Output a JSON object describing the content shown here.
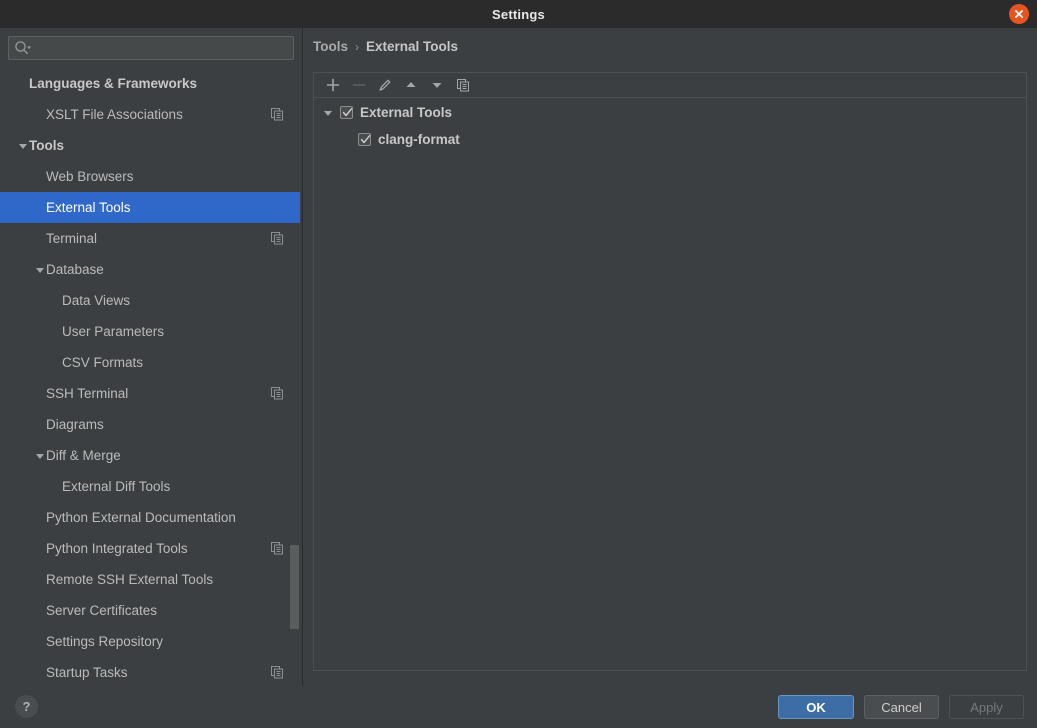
{
  "window": {
    "title": "Settings",
    "close_icon": "close-icon"
  },
  "sidebar": {
    "search": {
      "value": "",
      "placeholder": "",
      "icon": "search-icon"
    },
    "items": [
      {
        "label": "Languages & Frameworks",
        "level": 0,
        "bold": true,
        "arrow": "none",
        "selected": false,
        "badge": ""
      },
      {
        "label": "XSLT File Associations",
        "level": 1,
        "bold": false,
        "arrow": "none",
        "selected": false,
        "badge": "copy-icon"
      },
      {
        "label": "Tools",
        "level": 0,
        "bold": true,
        "arrow": "expanded",
        "selected": false,
        "badge": ""
      },
      {
        "label": "Web Browsers",
        "level": 1,
        "bold": false,
        "arrow": "none",
        "selected": false,
        "badge": ""
      },
      {
        "label": "External Tools",
        "level": 1,
        "bold": false,
        "arrow": "none",
        "selected": true,
        "badge": ""
      },
      {
        "label": "Terminal",
        "level": 1,
        "bold": false,
        "arrow": "none",
        "selected": false,
        "badge": "copy-icon"
      },
      {
        "label": "Database",
        "level": 1,
        "bold": false,
        "arrow": "expanded",
        "selected": false,
        "badge": ""
      },
      {
        "label": "Data Views",
        "level": 2,
        "bold": false,
        "arrow": "none",
        "selected": false,
        "badge": ""
      },
      {
        "label": "User Parameters",
        "level": 2,
        "bold": false,
        "arrow": "none",
        "selected": false,
        "badge": ""
      },
      {
        "label": "CSV Formats",
        "level": 2,
        "bold": false,
        "arrow": "none",
        "selected": false,
        "badge": ""
      },
      {
        "label": "SSH Terminal",
        "level": 1,
        "bold": false,
        "arrow": "none",
        "selected": false,
        "badge": "copy-icon"
      },
      {
        "label": "Diagrams",
        "level": 1,
        "bold": false,
        "arrow": "none",
        "selected": false,
        "badge": ""
      },
      {
        "label": "Diff & Merge",
        "level": 1,
        "bold": false,
        "arrow": "expanded",
        "selected": false,
        "badge": ""
      },
      {
        "label": "External Diff Tools",
        "level": 2,
        "bold": false,
        "arrow": "none",
        "selected": false,
        "badge": ""
      },
      {
        "label": "Python External Documentation",
        "level": 1,
        "bold": false,
        "arrow": "none",
        "selected": false,
        "badge": ""
      },
      {
        "label": "Python Integrated Tools",
        "level": 1,
        "bold": false,
        "arrow": "none",
        "selected": false,
        "badge": "copy-icon"
      },
      {
        "label": "Remote SSH External Tools",
        "level": 1,
        "bold": false,
        "arrow": "none",
        "selected": false,
        "badge": ""
      },
      {
        "label": "Server Certificates",
        "level": 1,
        "bold": false,
        "arrow": "none",
        "selected": false,
        "badge": ""
      },
      {
        "label": "Settings Repository",
        "level": 1,
        "bold": false,
        "arrow": "none",
        "selected": false,
        "badge": ""
      },
      {
        "label": "Startup Tasks",
        "level": 1,
        "bold": false,
        "arrow": "none",
        "selected": false,
        "badge": "copy-icon"
      }
    ]
  },
  "main": {
    "breadcrumb": {
      "parent": "Tools",
      "separator": "›",
      "current": "External Tools"
    },
    "toolbar": [
      {
        "name": "add-button",
        "icon": "plus-icon",
        "disabled": false
      },
      {
        "name": "remove-button",
        "icon": "minus-icon",
        "disabled": true
      },
      {
        "name": "edit-button",
        "icon": "pencil-icon",
        "disabled": false
      },
      {
        "name": "move-up-button",
        "icon": "arrow-up-icon",
        "disabled": false
      },
      {
        "name": "move-down-button",
        "icon": "arrow-down-icon",
        "disabled": false
      },
      {
        "name": "copy-button",
        "icon": "copy-icon",
        "disabled": false
      }
    ],
    "tree": [
      {
        "label": "External Tools",
        "level": 0,
        "checked": true,
        "arrow": "expanded"
      },
      {
        "label": "clang-format",
        "level": 1,
        "checked": true,
        "arrow": "none"
      }
    ]
  },
  "footer": {
    "help_label": "?",
    "ok_label": "OK",
    "cancel_label": "Cancel",
    "apply_label": "Apply"
  },
  "colors": {
    "background": "#3c3f41",
    "titlebar": "#2b2b2b",
    "selection": "#2f68c9",
    "close_button": "#e8541f",
    "default_button": "#3c6ea5",
    "text": "#bbbbbb"
  }
}
